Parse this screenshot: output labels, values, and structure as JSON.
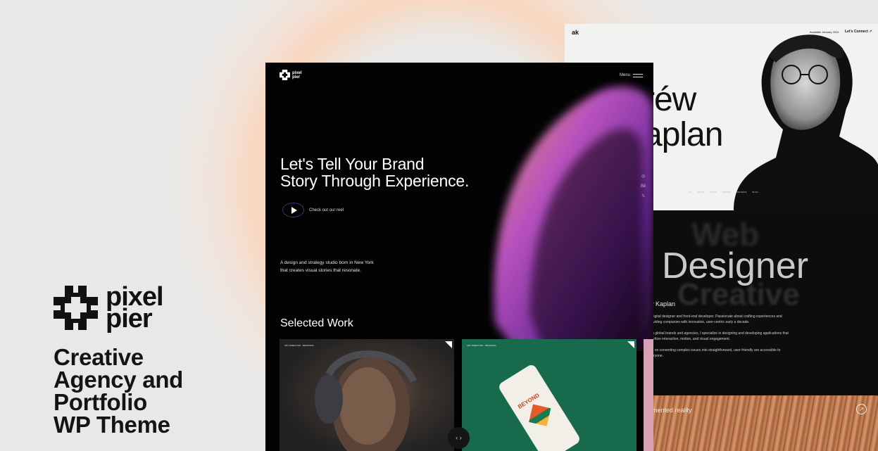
{
  "brand": {
    "name_line1": "pixel",
    "name_line2": "pier",
    "tagline_lines": [
      "Creative",
      "Agency and",
      "Portfolio",
      "WP Theme"
    ]
  },
  "main_preview": {
    "logo_line1": "pixel",
    "logo_line2": "pier",
    "menu_label": "Menu",
    "hero_line1": "Let's Tell Your Brand",
    "hero_line2": "Story Through Experience.",
    "reel_label": "Check out our reel",
    "about_line1": "A design and strategy studio born in  New York",
    "about_line2": "that creates visual stories that resonate.",
    "selected_work": "Selected Work",
    "socials": [
      "◎",
      "Bē",
      "𝕏"
    ],
    "cards": [
      {
        "tag": "ART DIRECTION · BRANDING"
      },
      {
        "tag": "ART DIRECTION · BRANDING",
        "can_text": "BEYOND"
      }
    ],
    "slider_arrows": "‹ ›"
  },
  "portfolio_preview": {
    "logo": "ak",
    "availability": "Available January 2024",
    "connect": "Let's Connect ↗",
    "name_line1": "réw",
    "name_line2": "aplan",
    "nav": [
      "AK",
      "ABOUT",
      "WORK",
      "AWARDS",
      "REVIEWS",
      "BLOG"
    ],
    "big_web": "Web",
    "big_designer": "Designer",
    "big_creative": "Creative",
    "person_name": "rew Kaplan",
    "bio_paragraphs": [
      "m digital designer and front-end developer. Passionate about crafting experiences and providing companies with innovative, user-centric early a decade.",
      "with global brands and agencies, I specialize in designing and developing applications that prioritize interaction, motion, and visual engagement.",
      "een on converting complex issues into straightforward, user-friendly are accessible to everyone."
    ],
    "augmented": "mented reality"
  },
  "colors": {
    "background": "#e9e8e6",
    "glow": "#fad6bc",
    "dark": "#030303",
    "green_card": "#186a4c",
    "accent_purple": "#7a6ad8"
  }
}
